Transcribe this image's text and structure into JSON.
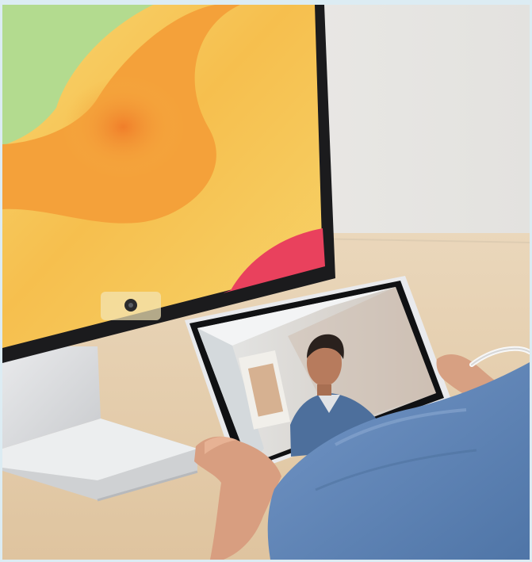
{
  "image": {
    "kind": "product-photo",
    "colors": {
      "frame": "#dcecf3",
      "wall": "#eceae6",
      "desk": "#e7d2b4",
      "monitor_bezel": "#1a1a1c",
      "monitor_stand": "#d9dadc",
      "wallpaper_yellow": "#f6c353",
      "wallpaper_orange": "#f39b35",
      "wallpaper_green": "#a9d88e",
      "wallpaper_red": "#e83a5c",
      "shirt": "#5f87b8",
      "skin": "#d79d7d"
    },
    "icons": [
      "camera-icon"
    ]
  }
}
